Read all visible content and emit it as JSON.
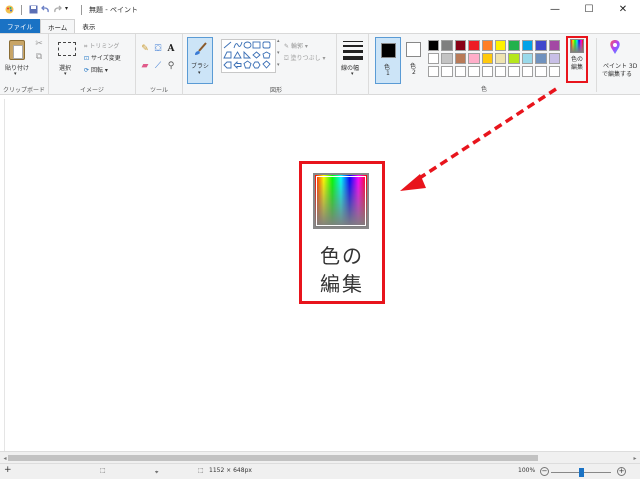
{
  "window": {
    "title": "無題 - ペイント",
    "minimize": "—",
    "maximize": "☐",
    "close": "✕"
  },
  "tabs": [
    {
      "label": "ファイル"
    },
    {
      "label": "ホーム"
    },
    {
      "label": "表示"
    }
  ],
  "ribbon": {
    "clipboard": {
      "paste": "貼り付け",
      "group": "クリップボード"
    },
    "image": {
      "select": "選択",
      "crop": "トリミング",
      "resize": "サイズ変更",
      "rotate": "回転",
      "group": "イメージ"
    },
    "tools": {
      "group": "ツール"
    },
    "brush": {
      "label": "ブラシ"
    },
    "shapes": {
      "outline": "輪郭",
      "fill": "塗りつぶし",
      "group": "図形"
    },
    "size": {
      "label": "線の幅"
    },
    "colors": {
      "color1": "色",
      "color1_num": "1",
      "color2": "色",
      "color2_num": "2",
      "group": "色",
      "edit_colors": "色の編集",
      "edit_line1": "色の",
      "edit_line2": "編集"
    },
    "paint3d": {
      "line1": "ペイント 3D",
      "line2": "で編集する"
    }
  },
  "palette": [
    [
      "#000000",
      "#7f7f7f",
      "#880015",
      "#ed1c24",
      "#ff7f27",
      "#fff200",
      "#22b14c",
      "#00a2e8",
      "#3f48cc",
      "#a349a4"
    ],
    [
      "#ffffff",
      "#c3c3c3",
      "#b97a57",
      "#ffaec9",
      "#ffc90e",
      "#efe4b0",
      "#b5e61d",
      "#99d9ea",
      "#7092be",
      "#c8bfe7"
    ],
    [
      "#ffffff",
      "#ffffff",
      "#ffffff",
      "#ffffff",
      "#ffffff",
      "#ffffff",
      "#ffffff",
      "#ffffff",
      "#ffffff",
      "#ffffff"
    ]
  ],
  "callout": {
    "line1": "色の",
    "line2": "編集"
  },
  "status": {
    "image_size": "1152 × 648px",
    "zoom": "100%"
  },
  "colors": {
    "highlight": "#e8141c",
    "accent": "#1a72c4"
  }
}
